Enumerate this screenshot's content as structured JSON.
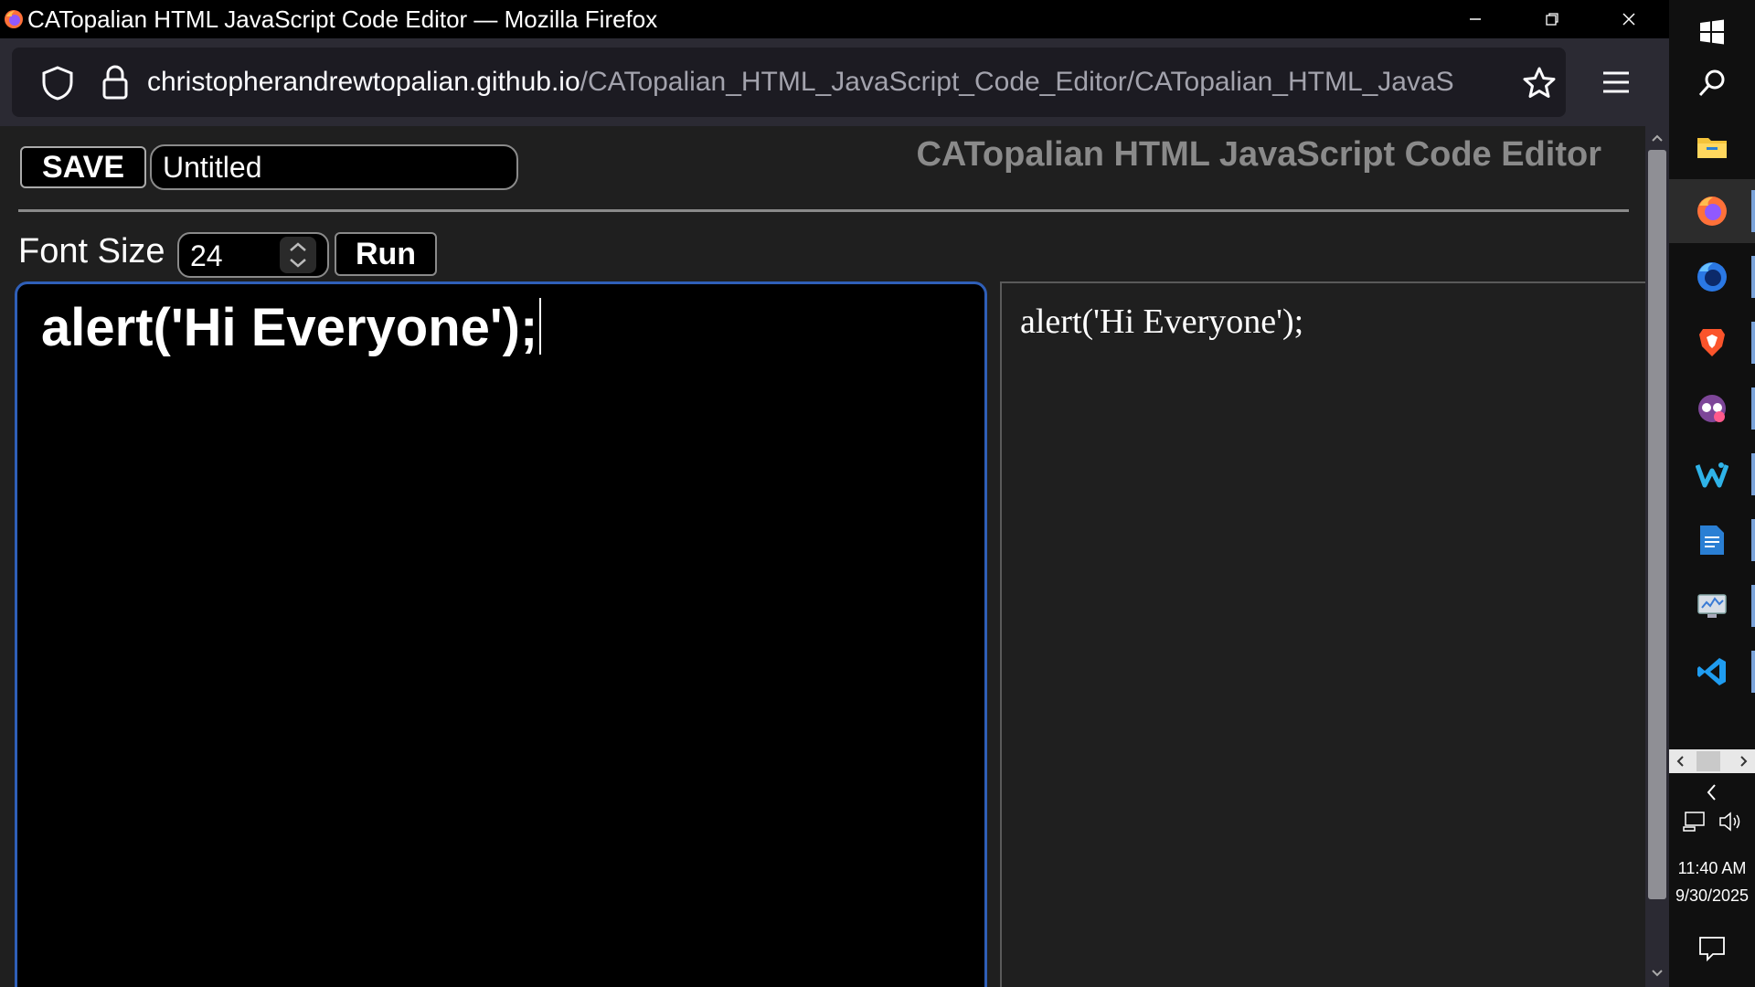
{
  "window": {
    "title": "CATopalian HTML JavaScript Code Editor — Mozilla Firefox"
  },
  "browser": {
    "url_host": "christopherandrewtopalian.github.io",
    "url_path": "/CATopalian_HTML_JavaScript_Code_Editor/CATopalian_HTML_JavaS"
  },
  "page": {
    "save_label": "SAVE",
    "filename_value": "Untitled",
    "app_title": "CATopalian HTML JavaScript Code Editor",
    "font_size_label": "Font Size",
    "font_size_value": "24",
    "run_label": "Run",
    "code": "alert('Hi Everyone');",
    "output": "alert('Hi Everyone');"
  },
  "taskbar": {
    "items": [
      {
        "name": "windows-start-icon"
      },
      {
        "name": "search-icon"
      },
      {
        "name": "file-explorer-icon"
      },
      {
        "name": "firefox-icon",
        "active": true
      },
      {
        "name": "firefox-developer-icon"
      },
      {
        "name": "brave-icon"
      },
      {
        "name": "tor-browser-icon"
      },
      {
        "name": "waterfox-icon"
      },
      {
        "name": "document-app-icon"
      },
      {
        "name": "system-monitor-icon"
      },
      {
        "name": "vscode-icon"
      }
    ],
    "clock_time": "11:40 AM",
    "clock_date": "9/30/2025"
  },
  "colors": {
    "accent_blue": "#2f5fb8",
    "page_bg": "#1f1f1f",
    "title_gray": "#8a8a8a"
  }
}
